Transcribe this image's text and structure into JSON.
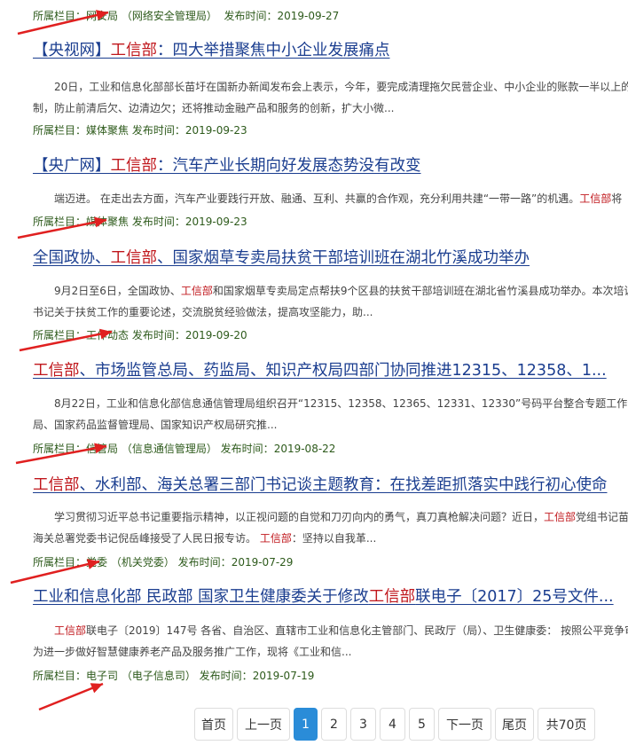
{
  "labels": {
    "column": "所属栏目：",
    "published": "发布时间："
  },
  "top_meta": {
    "column": "网安局 （网络安全管理局）",
    "date": "2019-09-27"
  },
  "articles": [
    {
      "title_pre": "【央视网】",
      "title_hl": "工信部",
      "title_post": "：四大举措聚焦中小企业发展痛点",
      "summary_lines": [
        [
          "20日，工业和信息化部部长苗圩在国新办新闻发布会上表示，今年，要完成清理拖欠民营企业、中小企业的账款一半以上的"
        ],
        [
          "制，防止前清后欠、边清边欠；还将推动金融产品和服务的创新，扩大小微..."
        ]
      ],
      "column": "媒体聚焦",
      "date": "2019-09-23"
    },
    {
      "title_pre": "【央广网】",
      "title_hl": "工信部",
      "title_post": "：汽车产业长期向好发展态势没有改变",
      "summary_lines": [
        [
          "端迈进。 在走出去方面，汽车产业要践行开放、融通、互利、共赢的合作观，充分利用共建“一带一路”的机遇。",
          "工信部",
          "将"
        ]
      ],
      "column": "媒体聚焦",
      "date": "2019-09-23"
    },
    {
      "title_pre": "全国政协、",
      "title_hl": "工信部",
      "title_post": "、国家烟草专卖局扶贫干部培训班在湖北竹溪成功举办",
      "summary_lines": [
        [
          "9月2日至6日，全国政协、",
          "工信部",
          "和国家烟草专卖局定点帮扶9个区县的扶贫干部培训班在湖北省竹溪县成功举办。本次培训"
        ],
        [
          "书记关于扶贫工作的重要论述，交流脱贫经验做法，提高攻坚能力，助..."
        ]
      ],
      "column": "工作动态",
      "date": "2019-09-20"
    },
    {
      "title_pre": "",
      "title_hl": "工信部",
      "title_post": "、市场监管总局、药监局、知识产权局四部门协同推进12315、12358、1...",
      "summary_lines": [
        [
          "8月22日，工业和信息化部信息通信管理局组织召开“12315、12358、12365、12331、12330”号码平台整合专题工作会"
        ],
        [
          "局、国家药品监督管理局、国家知识产权局研究推..."
        ]
      ],
      "column": "信管局 （信息通信管理局）",
      "date": "2019-08-22"
    },
    {
      "title_pre": "",
      "title_hl": "工信部",
      "title_post": "、水利部、海关总署三部门书记谈主题教育：在找差距抓落实中践行初心使命",
      "summary_lines": [
        [
          "学习贯彻习近平总书记重要指示精神，以正视问题的自觉和刀刃向内的勇气，真刀真枪解决问题？近日，",
          "工信部",
          "党组书记苗"
        ],
        [
          "海关总署党委书记倪岳峰接受了人民日报专访。 ",
          "工信部",
          "：坚持以自我革..."
        ]
      ],
      "column": "党委 （机关党委）",
      "date": "2019-07-29"
    },
    {
      "title_pre": "工业和信息化部 民政部 国家卫生健康委关于修改",
      "title_hl": "工信部",
      "title_post": "联电子〔2017〕25号文件...",
      "summary_lines": [
        [
          "",
          "工信部",
          "联电子〔2019〕147号 各省、自治区、直辖市工业和信息化主管部门、民政厅（局）、卫生健康委： 按照公平竞争审"
        ],
        [
          "为进一步做好智慧健康养老产品及服务推广工作，现将《工业和信..."
        ]
      ],
      "column": "电子司 （电子信息司）",
      "date": "2019-07-19"
    }
  ],
  "pagination": {
    "first": "首页",
    "prev": "上一页",
    "pages": [
      "1",
      "2",
      "3",
      "4",
      "5"
    ],
    "current": "1",
    "next": "下一页",
    "last": "尾页",
    "total": "共70页"
  },
  "colors": {
    "highlight": "#c0171c",
    "title": "#1a3d8f",
    "meta": "#2d5a1b",
    "arrow": "#e02020",
    "pager_active": "#2a8cd8"
  }
}
